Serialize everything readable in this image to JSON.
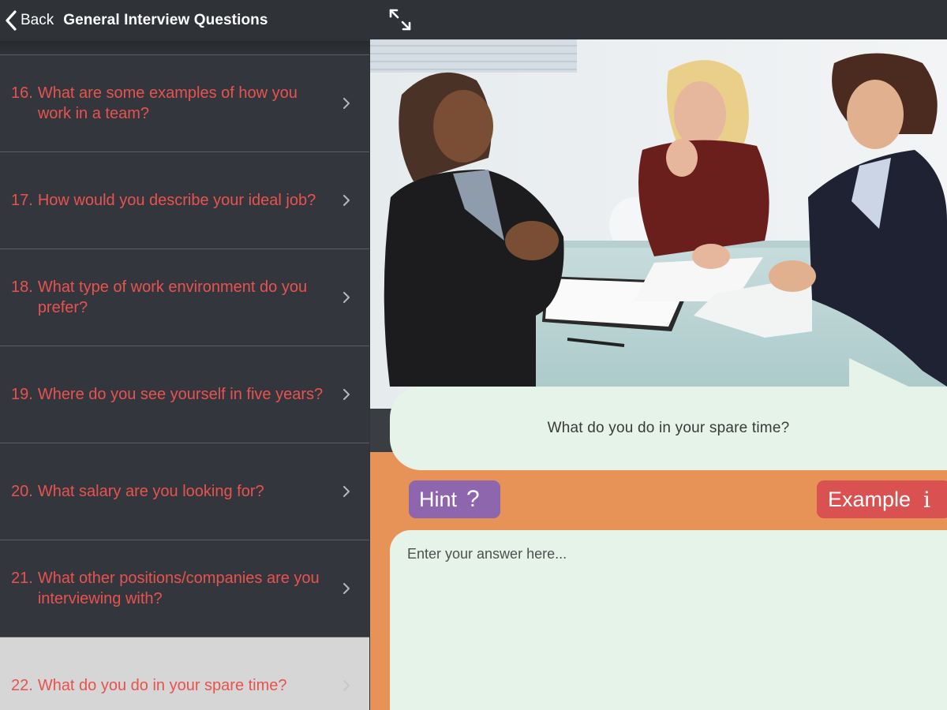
{
  "left_header": {
    "back_label": "Back",
    "title": "General Interview Questions"
  },
  "questions": [
    {
      "number": "16.",
      "text": "What are some examples of how you work in a team?",
      "selected": false
    },
    {
      "number": "17.",
      "text": "How would you describe your ideal job?",
      "selected": false
    },
    {
      "number": "18.",
      "text": "What type of work environment do you prefer?",
      "selected": false
    },
    {
      "number": "19.",
      "text": "Where do you see yourself in five years?",
      "selected": false
    },
    {
      "number": "20.",
      "text": "What salary are you looking for?",
      "selected": false
    },
    {
      "number": "21.",
      "text": "What other positions/companies are you interviewing with?",
      "selected": false
    },
    {
      "number": "22.",
      "text": "What do you do in your spare time?",
      "selected": true
    }
  ],
  "right_header": {
    "expand_icon": "expand-arrows-icon"
  },
  "current_question": {
    "text": "What do you do in your spare time?"
  },
  "hint_button": {
    "label": "Hint",
    "icon": "?"
  },
  "example_button": {
    "label": "Example",
    "icon": "i"
  },
  "answer": {
    "placeholder": "Enter your answer here...",
    "value": ""
  },
  "colors": {
    "question_text": "#e8524f",
    "panel_dark": "#33373d",
    "orange_background": "#e79257",
    "bubble_background": "#e5f3e8",
    "hint_purple": "#8d66ad",
    "example_red": "#da5152"
  }
}
